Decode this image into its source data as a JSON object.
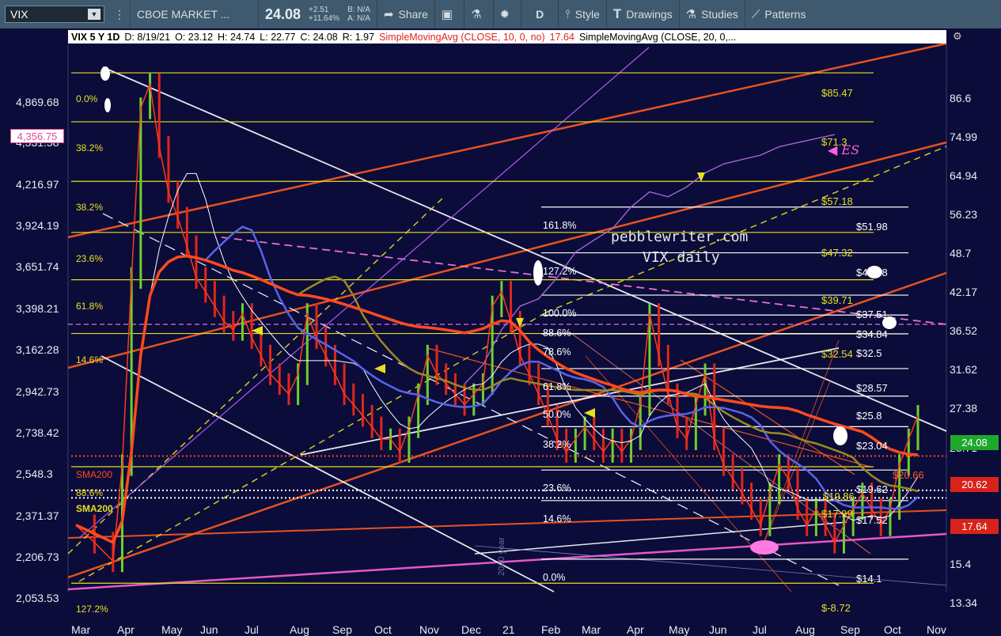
{
  "toolbar": {
    "symbol": "VIX",
    "symbol_description": "CBOE MARKET ...",
    "last_price": "24.08",
    "change": "+2.51",
    "change_pct": "+11.64%",
    "bid": "B: N/A",
    "ask": "A: N/A",
    "share_label": "Share",
    "period_label": "D",
    "style_label": "Style",
    "drawings_label": "Drawings",
    "studies_label": "Studies",
    "patterns_label": "Patterns"
  },
  "infobar": {
    "title": "VIX 5 Y 1D",
    "date": "D: 8/19/21",
    "open": "O: 23.12",
    "high": "H: 24.74",
    "low": "L: 22.77",
    "close": "C: 24.08",
    "range": "R: 1.97",
    "sma10_label": "SimpleMovingAvg (CLOSE, 10, 0, no)",
    "sma10_value": "17.64",
    "sma20_label": "SimpleMovingAvg (CLOSE, 20, 0,..."
  },
  "annotations": {
    "brand": "pebblewriter.com",
    "chart_name": "VIX daily",
    "es_label": "ES",
    "es_current": "4,356.75",
    "sma200_a": "SMA200",
    "sma200_b": "SMA200",
    "year_mark": "2020 year"
  },
  "colors": {
    "background": "#0b0c3a",
    "candle_up": "#6fcf2c",
    "candle_down": "#e0261c",
    "es_line": "#b06ae0",
    "fib_yellow": "#e6e01e",
    "white": "#ffffff",
    "orange": "#ff5a1e",
    "pink": "#ff60d8",
    "olive": "#9a8a1e",
    "blue_ma": "#5a64e8"
  },
  "chart_data": {
    "type": "candlestick",
    "xlabel": "",
    "ylabel": "",
    "x_ticks": [
      "Mar",
      "Apr",
      "May",
      "Jun",
      "Jul",
      "Aug",
      "Sep",
      "Oct",
      "Nov",
      "Dec",
      "21",
      "Feb",
      "Mar",
      "Apr",
      "May",
      "Jun",
      "Jul",
      "Aug",
      "Sep",
      "Oct",
      "Nov"
    ],
    "y_ticks_right": [
      "86.6",
      "74.99",
      "64.94",
      "56.23",
      "48.7",
      "42.17",
      "36.52",
      "31.62",
      "27.38",
      "23.71",
      "20.53",
      "17.78",
      "15.4",
      "13.34"
    ],
    "y_ticks_left": [
      "4,869.68",
      "4,531.58",
      "4,216.97",
      "3,924.19",
      "3,651.74",
      "3,398.21",
      "3,162.28",
      "2,942.73",
      "2,738.42",
      "2,548.3",
      "2,371.37",
      "2,206.73",
      "2,053.53"
    ],
    "ylim": [
      12.5,
      95
    ],
    "y_scale": "log",
    "current_value": "24.08",
    "price_tags": [
      {
        "text": "24.08",
        "value": 24.08,
        "color": "#1ea82c"
      },
      {
        "text": "20.62",
        "value": 20.62,
        "color": "#d8231a"
      },
      {
        "text": "17.64",
        "value": 17.64,
        "color": "#d8231a"
      }
    ],
    "fib_left": [
      {
        "text": "0.0%",
        "value": 85.47
      },
      {
        "text": "38.2%",
        "value": 71.3
      },
      {
        "text": "38.2%",
        "value": 57.18
      },
      {
        "text": "23.6%",
        "value": 47.32
      },
      {
        "text": "61.8%",
        "value": 39.71
      },
      {
        "text": "14.6%",
        "value": 32.54
      },
      {
        "text": "88.6%",
        "value": 19.86
      },
      {
        "text": "127.2%",
        "value": 12.9
      }
    ],
    "fib_left_values": [
      {
        "text": "$85.47",
        "value": 85.47
      },
      {
        "text": "$71.3",
        "value": 71.3
      },
      {
        "text": "$57.18",
        "value": 57.18
      },
      {
        "text": "$47.32",
        "value": 47.32
      },
      {
        "text": "$39.71",
        "value": 39.71
      },
      {
        "text": "$32.54",
        "value": 32.54
      },
      {
        "text": "$17.99",
        "value": 17.99
      }
    ],
    "fib_right": [
      {
        "pct": "161.8%",
        "text": "$51.98",
        "value": 51.98
      },
      {
        "pct": "127.2%",
        "text": "$43.88",
        "value": 43.88
      },
      {
        "pct": "100.0%",
        "text": "$37.51",
        "value": 37.51
      },
      {
        "pct": "88.6%",
        "text": "$34.84",
        "value": 34.84
      },
      {
        "pct": "78.6%",
        "text": "$32.5",
        "value": 32.5
      },
      {
        "pct": "61.8%",
        "text": "$28.57",
        "value": 28.57
      },
      {
        "pct": "50.0%",
        "text": "$25.8",
        "value": 25.8
      },
      {
        "pct": "38.2%",
        "text": "$23.04",
        "value": 23.04
      },
      {
        "pct": "23.6%",
        "text": "$19.62",
        "value": 19.62
      },
      {
        "pct": "14.6%",
        "text": "$17.52",
        "value": 17.52
      },
      {
        "pct": "0.0%",
        "text": "$14.1",
        "value": 14.1
      }
    ],
    "extra_labels": [
      {
        "text": "$20.66",
        "value": 20.66
      },
      {
        "text": "$19.86",
        "value": 19.86
      },
      {
        "text": "$-8.72",
        "value": 12.9
      }
    ],
    "vix_path": [
      [
        0,
        16
      ],
      [
        2,
        15
      ],
      [
        4,
        14
      ],
      [
        5,
        20
      ],
      [
        6,
        40
      ],
      [
        7,
        75
      ],
      [
        8,
        82
      ],
      [
        9,
        65
      ],
      [
        10,
        55
      ],
      [
        11,
        50
      ],
      [
        12,
        45
      ],
      [
        13,
        40
      ],
      [
        14,
        38
      ],
      [
        15,
        36
      ],
      [
        16,
        34
      ],
      [
        17,
        33
      ],
      [
        18,
        35
      ],
      [
        19,
        32
      ],
      [
        20,
        30
      ],
      [
        21,
        28
      ],
      [
        22,
        27
      ],
      [
        23,
        26
      ],
      [
        24,
        28
      ],
      [
        25,
        35
      ],
      [
        26,
        32
      ],
      [
        27,
        30
      ],
      [
        28,
        28
      ],
      [
        29,
        26
      ],
      [
        30,
        25
      ],
      [
        31,
        24
      ],
      [
        32,
        23
      ],
      [
        33,
        22
      ],
      [
        34,
        22
      ],
      [
        35,
        21
      ],
      [
        36,
        23
      ],
      [
        37,
        26
      ],
      [
        38,
        30
      ],
      [
        39,
        28
      ],
      [
        40,
        27
      ],
      [
        41,
        26
      ],
      [
        42,
        25
      ],
      [
        43,
        26
      ],
      [
        44,
        27
      ],
      [
        45,
        36
      ],
      [
        46,
        38
      ],
      [
        47,
        34
      ],
      [
        48,
        30
      ],
      [
        49,
        28
      ],
      [
        50,
        26
      ],
      [
        51,
        24
      ],
      [
        52,
        22
      ],
      [
        53,
        21
      ],
      [
        54,
        22
      ],
      [
        55,
        23
      ],
      [
        56,
        22
      ],
      [
        57,
        21
      ],
      [
        58,
        22
      ],
      [
        59,
        21
      ],
      [
        60,
        22
      ],
      [
        61,
        25
      ],
      [
        62,
        35
      ],
      [
        63,
        30
      ],
      [
        64,
        26
      ],
      [
        65,
        23
      ],
      [
        66,
        22
      ],
      [
        67,
        25
      ],
      [
        68,
        28
      ],
      [
        69,
        22
      ],
      [
        70,
        20
      ],
      [
        71,
        19
      ],
      [
        72,
        18
      ],
      [
        73,
        17
      ],
      [
        74,
        16
      ],
      [
        75,
        18
      ],
      [
        76,
        20
      ],
      [
        77,
        19
      ],
      [
        78,
        17
      ],
      [
        79,
        16
      ],
      [
        80,
        17
      ],
      [
        81,
        16
      ],
      [
        82,
        15
      ],
      [
        83,
        16
      ],
      [
        84,
        17
      ],
      [
        85,
        18
      ],
      [
        86,
        17
      ],
      [
        87,
        16
      ],
      [
        88,
        17
      ],
      [
        89,
        20
      ],
      [
        90,
        22
      ],
      [
        91,
        24
      ]
    ],
    "es_path": [
      [
        42,
        27
      ],
      [
        44,
        29
      ],
      [
        46,
        33
      ],
      [
        48,
        36
      ],
      [
        50,
        37
      ],
      [
        52,
        40
      ],
      [
        54,
        44
      ],
      [
        56,
        46
      ],
      [
        58,
        48
      ],
      [
        60,
        52
      ],
      [
        62,
        55
      ],
      [
        64,
        54
      ],
      [
        66,
        56
      ],
      [
        68,
        59
      ],
      [
        70,
        61
      ],
      [
        72,
        62
      ],
      [
        74,
        63
      ],
      [
        76,
        65
      ],
      [
        78,
        66
      ],
      [
        80,
        67
      ],
      [
        82,
        68
      ]
    ]
  }
}
